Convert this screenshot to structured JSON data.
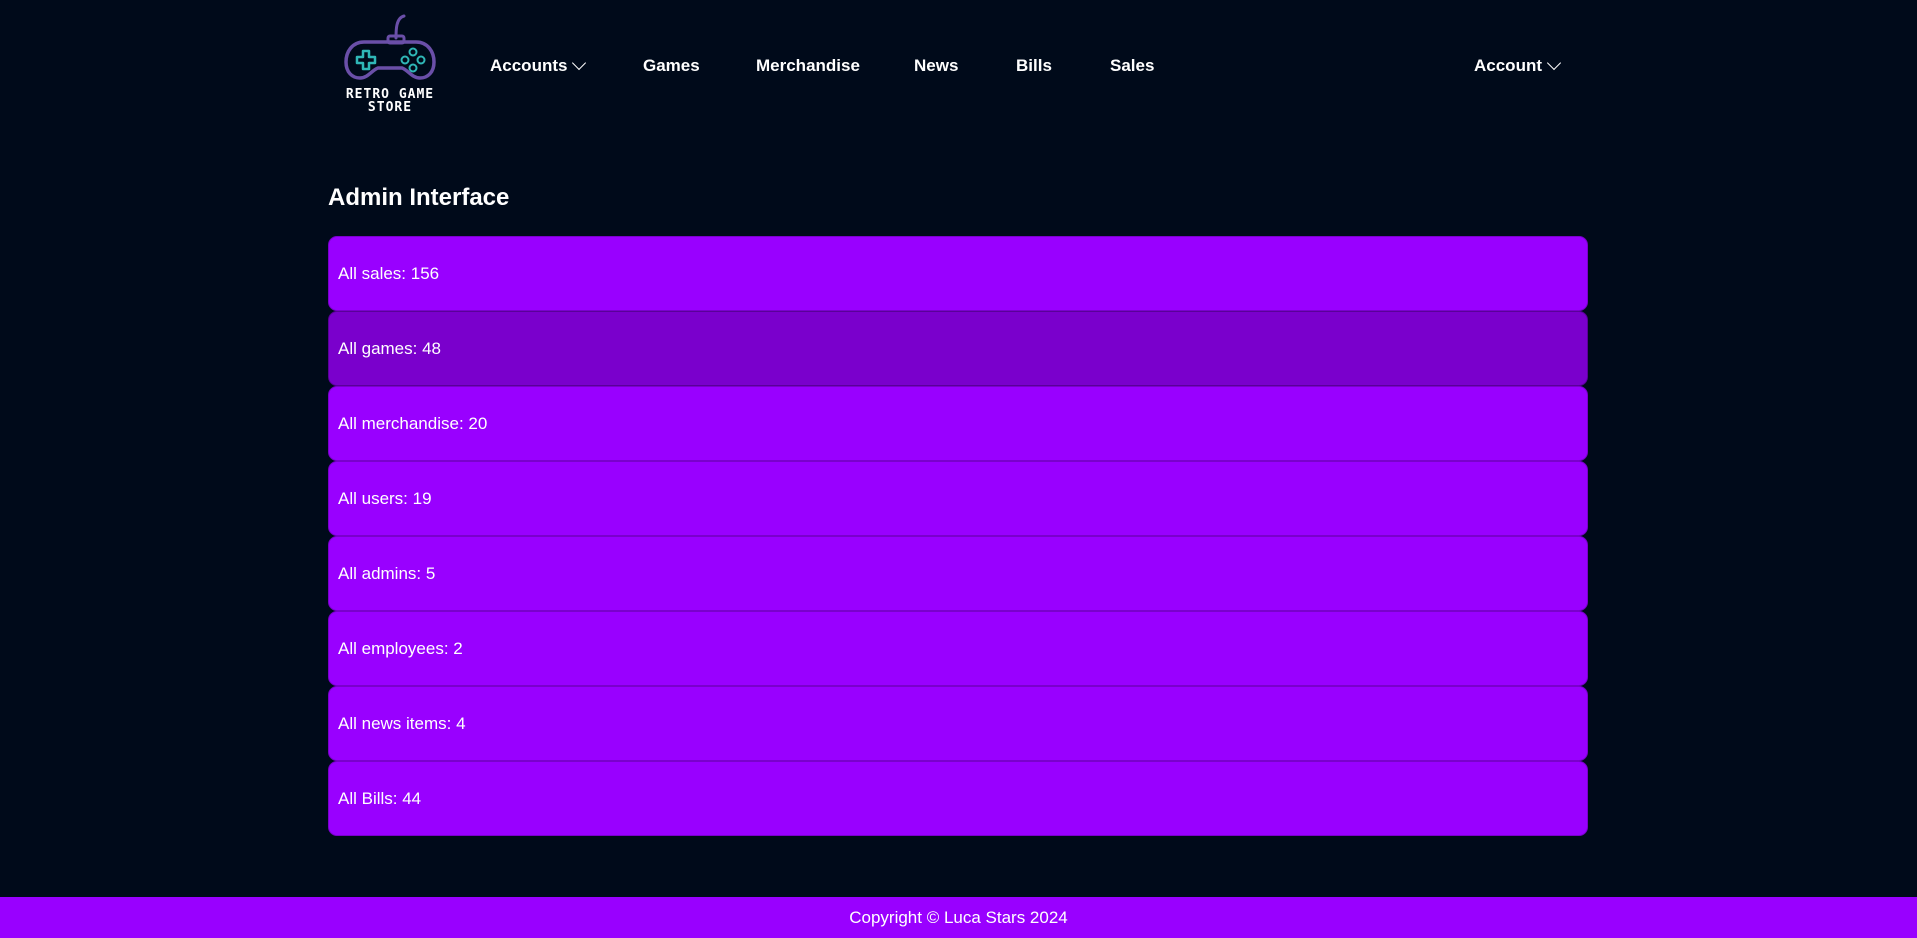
{
  "brand": {
    "logo_line1": "RETRO GAME",
    "logo_line2": "STORE",
    "logo_icon": "gamepad-icon"
  },
  "nav": {
    "accounts": "Accounts",
    "games": "Games",
    "merchandise": "Merchandise",
    "news": "News",
    "bills": "Bills",
    "sales": "Sales",
    "account": "Account"
  },
  "main": {
    "title": "Admin Interface",
    "stats": [
      {
        "label": "All sales: 156"
      },
      {
        "label": "All games: 48"
      },
      {
        "label": "All merchandise: 20"
      },
      {
        "label": "All users: 19"
      },
      {
        "label": "All admins: 5"
      },
      {
        "label": "All employees: 2"
      },
      {
        "label": "All news items: 4"
      },
      {
        "label": "All Bills: 44"
      }
    ]
  },
  "footer": {
    "copyright": "Copyright © Luca Stars 2024"
  },
  "colors": {
    "background": "#000a1a",
    "accent": "#9900ff",
    "accent_hover": "#7a00cc",
    "logo_outline": "#6a4fa8",
    "logo_teal": "#2fb7b7"
  }
}
